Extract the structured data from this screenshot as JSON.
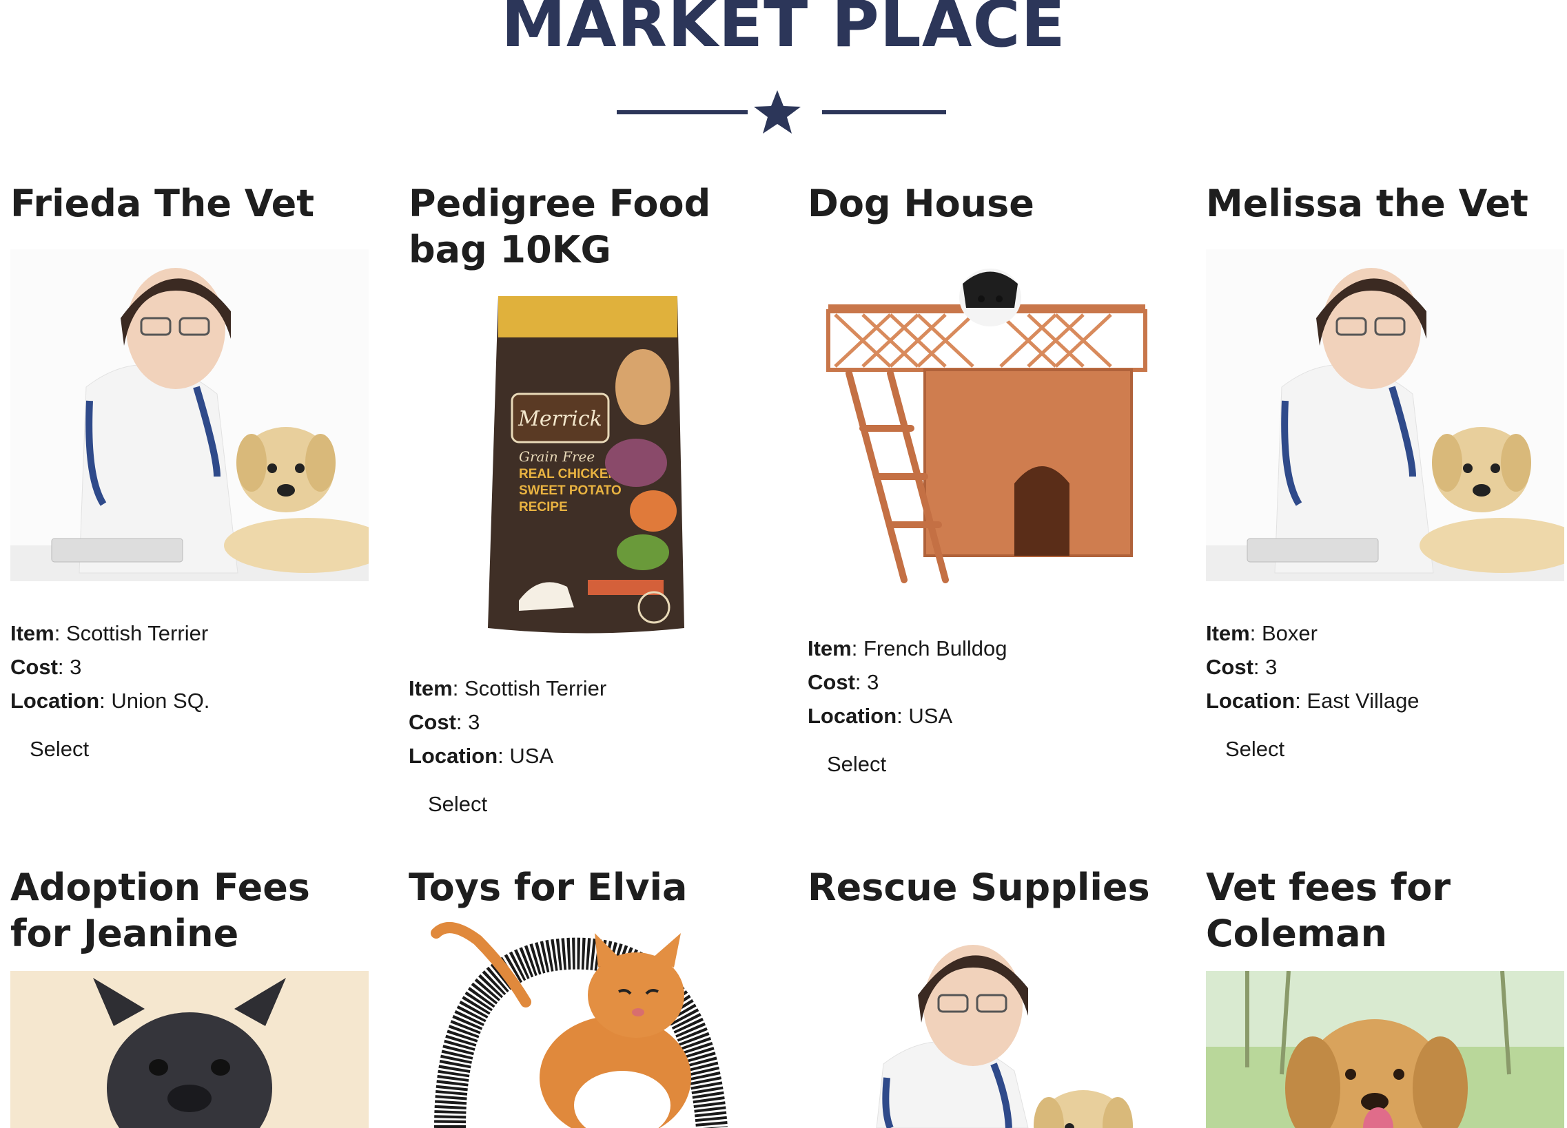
{
  "page": {
    "title": "MARKET PLACE"
  },
  "labels": {
    "item": "Item",
    "cost": "Cost",
    "location": "Location",
    "select": "Select"
  },
  "products": [
    {
      "name": "Frieda The Vet",
      "item": "Scottish Terrier",
      "cost": "3",
      "location": "Union SQ.",
      "image": "vet-with-puppy"
    },
    {
      "name": "Pedigree Food bag 10KG",
      "item": "Scottish Terrier",
      "cost": "3",
      "location": "USA",
      "image": "dog-food-bag",
      "image_text": {
        "brand": "Merrick",
        "line1": "Grain Free",
        "line2": "REAL CHICKEN +",
        "line3": "SWEET POTATO",
        "line4": "RECIPE"
      }
    },
    {
      "name": "Dog House",
      "item": "French Bulldog",
      "cost": "3",
      "location": "USA",
      "image": "wooden-dog-house"
    },
    {
      "name": "Melissa the Vet",
      "item": "Boxer",
      "cost": "3",
      "location": "East Village",
      "image": "vet-with-puppy"
    },
    {
      "name": "Adoption Fees for Jeanine",
      "image": "french-bulldog"
    },
    {
      "name": "Toys for Elvia",
      "image": "cat-with-brush-arch"
    },
    {
      "name": "Rescue Supplies",
      "image": "vet-with-puppy"
    },
    {
      "name": "Vet fees for Coleman",
      "image": "golden-retriever"
    }
  ],
  "colors": {
    "title": "#2c3659",
    "accent": "#2c3659",
    "text": "#1a1a1a"
  }
}
